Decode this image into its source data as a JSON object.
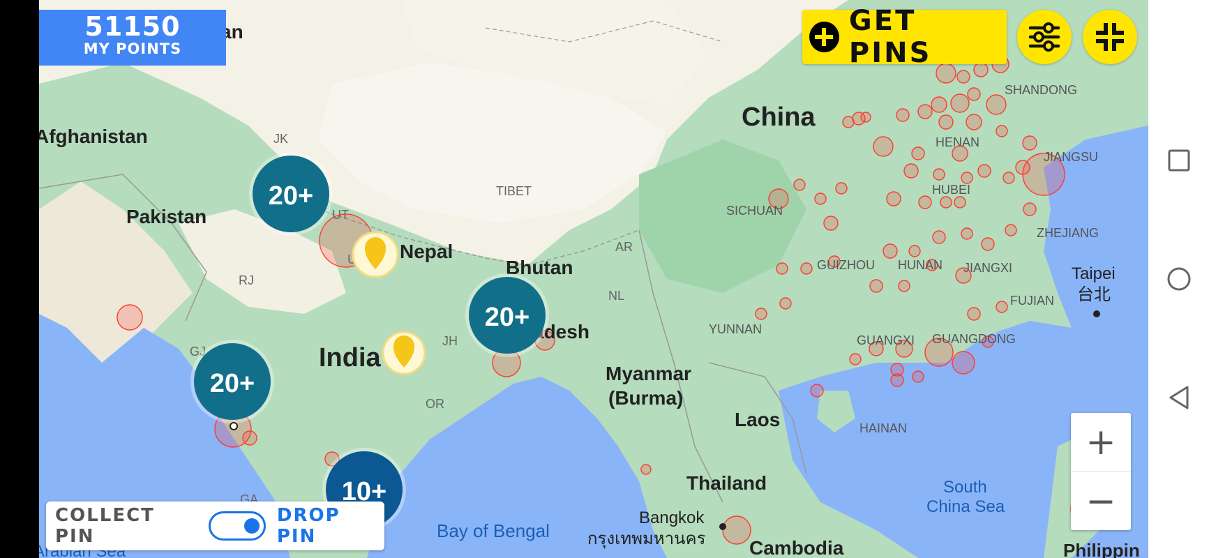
{
  "points": {
    "value": "51150",
    "label": "MY POINTS"
  },
  "get_pins": {
    "label": "GET PINS"
  },
  "toggle": {
    "collect_label": "COLLECT PIN",
    "drop_label": "DROP PIN",
    "state": "drop"
  },
  "zoom": {
    "in_label": "+",
    "out_label": "−"
  },
  "clusters": [
    {
      "label": "20+",
      "color": "#126f8a"
    },
    {
      "label": "20+",
      "color": "#126f8a"
    },
    {
      "label": "20+",
      "color": "#126f8a"
    },
    {
      "label": "10+",
      "color": "#0b5892"
    }
  ],
  "map_labels": {
    "afghanistan": "Afghanistan",
    "pakistan": "Pakistan",
    "india": "India",
    "nepal": "Nepal",
    "bhutan": "Bhutan",
    "bangladesh": "adesh",
    "china": "China",
    "tibet": "TIBET",
    "myanmar": "Myanmar\n(Burma)",
    "laos": "Laos",
    "thailand": "Thailand",
    "cambodia": "Cambodia",
    "bangkok": "Bangkok",
    "bangkok_thai": "กรุงเทพมหานคร",
    "taipei": "Taipei",
    "taipei_zh": "台北",
    "philippines": "Philippin",
    "shandong": "SHANDONG",
    "henan": "HENAN",
    "jiangsu": "JIANGSU",
    "hubei": "HUBEI",
    "sichuan": "SICHUAN",
    "zhejiang": "ZHEJIANG",
    "guizhou": "GUIZHOU",
    "hunan": "HUNAN",
    "jiangxi": "JIANGXI",
    "fujian": "FUJIAN",
    "yunnan": "YUNNAN",
    "guangxi": "GUANGXI",
    "guangdong": "GUANGDONG",
    "hainan": "HAINAN",
    "south_china_sea": "South\nChina Sea",
    "bay_of_bengal": "Bay of Bengal",
    "arabian_sea": "Arabian Sea",
    "jk": "JK",
    "ut": "UT",
    "rj": "RJ",
    "gj": "GJ",
    "jh": "JH",
    "or": "OR",
    "ga": "GA",
    "ar": "AR",
    "nl": "NL",
    "an": "an",
    "u": "U"
  },
  "icons": [
    "plus-circle-icon",
    "filter-sliders-icon",
    "collapse-icon",
    "map-pin-icon",
    "square-nav-icon",
    "circle-nav-icon",
    "back-triangle-icon"
  ],
  "colors": {
    "accent_yellow": "#ffe500",
    "points_blue": "#4285f4",
    "water": "#8ab4f8",
    "land_green": "#a8dab5",
    "pin_red": "#ff3b30"
  }
}
